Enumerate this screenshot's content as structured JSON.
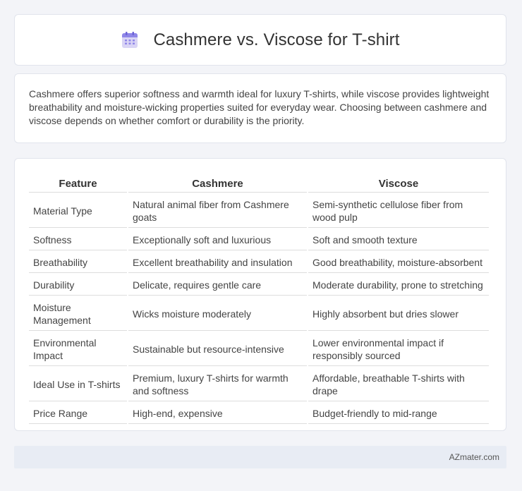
{
  "header": {
    "title": "Cashmere vs. Viscose for T-shirt",
    "icon": "calendar-icon"
  },
  "intro": {
    "text": "Cashmere offers superior softness and warmth ideal for luxury T-shirts, while viscose provides lightweight breathability and moisture-wicking properties suited for everyday wear. Choosing between cashmere and viscose depends on whether comfort or durability is the priority."
  },
  "table": {
    "headers": [
      "Feature",
      "Cashmere",
      "Viscose"
    ],
    "rows": [
      [
        "Material Type",
        "Natural animal fiber from Cashmere goats",
        "Semi-synthetic cellulose fiber from wood pulp"
      ],
      [
        "Softness",
        "Exceptionally soft and luxurious",
        "Soft and smooth texture"
      ],
      [
        "Breathability",
        "Excellent breathability and insulation",
        "Good breathability, moisture-absorbent"
      ],
      [
        "Durability",
        "Delicate, requires gentle care",
        "Moderate durability, prone to stretching"
      ],
      [
        "Moisture Management",
        "Wicks moisture moderately",
        "Highly absorbent but dries slower"
      ],
      [
        "Environmental Impact",
        "Sustainable but resource-intensive",
        "Lower environmental impact if responsibly sourced"
      ],
      [
        "Ideal Use in T-shirts",
        "Premium, luxury T-shirts for warmth and softness",
        "Affordable, breathable T-shirts with drape"
      ],
      [
        "Price Range",
        "High-end, expensive",
        "Budget-friendly to mid-range"
      ]
    ]
  },
  "footer": {
    "text": "AZmater.com"
  }
}
